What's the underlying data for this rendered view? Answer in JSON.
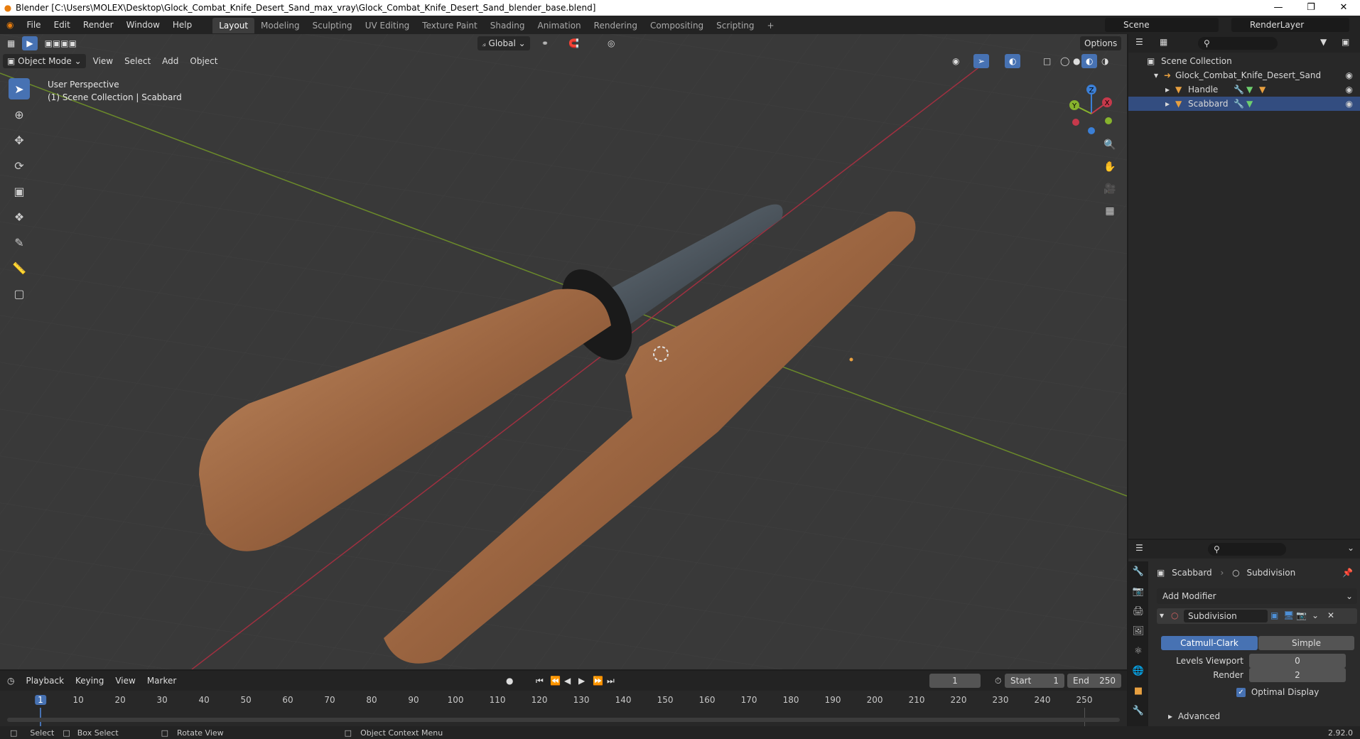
{
  "window": {
    "title": "Blender [C:\\Users\\MOLEX\\Desktop\\Glock_Combat_Knife_Desert_Sand_max_vray\\Glock_Combat_Knife_Desert_Sand_blender_base.blend]",
    "minimize": "—",
    "restore": "❐",
    "close": "✕"
  },
  "menu": [
    "File",
    "Edit",
    "Render",
    "Window",
    "Help"
  ],
  "workspaces": [
    "Layout",
    "Modeling",
    "Sculpting",
    "UV Editing",
    "Texture Paint",
    "Shading",
    "Animation",
    "Rendering",
    "Compositing",
    "Scripting"
  ],
  "workspace_add": "+",
  "scene": {
    "name": "Scene",
    "render_layer": "RenderLayer"
  },
  "viewport": {
    "orientation": "Global",
    "options": "Options",
    "mode": "Object Mode",
    "menus": [
      "View",
      "Select",
      "Add",
      "Object"
    ],
    "info_line1": "User Perspective",
    "info_line2": "(1) Scene Collection | Scabbard",
    "gizmo": {
      "x": "X",
      "y": "Y",
      "z": "Z"
    }
  },
  "outliner": {
    "root": "Scene Collection",
    "collection": "Glock_Combat_Knife_Desert_Sand",
    "objects": [
      "Handle",
      "Scabbard"
    ]
  },
  "properties": {
    "object": "Scabbard",
    "modifier_tab": "Subdivision",
    "add_modifier": "Add Modifier",
    "modifier_name": "Subdivision",
    "method_a": "Catmull-Clark",
    "method_b": "Simple",
    "levels_viewport_label": "Levels Viewport",
    "levels_viewport": "0",
    "render_label": "Render",
    "render": "2",
    "optimal_display": "Optimal Display",
    "advanced": "Advanced"
  },
  "timeline": {
    "menus": [
      "Playback",
      "Keying",
      "View",
      "Marker"
    ],
    "current_frame": "1",
    "start_label": "Start",
    "start": "1",
    "end_label": "End",
    "end": "250",
    "ticks": [
      "1",
      "10",
      "20",
      "30",
      "40",
      "50",
      "60",
      "70",
      "80",
      "90",
      "100",
      "110",
      "120",
      "130",
      "140",
      "150",
      "160",
      "170",
      "180",
      "190",
      "200",
      "210",
      "220",
      "230",
      "240",
      "250"
    ]
  },
  "status": {
    "select": "Select",
    "box_select": "Box Select",
    "rotate_view": "Rotate View",
    "context_menu": "Object Context Menu",
    "version": "2.92.0"
  },
  "colors": {
    "accent": "#4772b3",
    "x_axis": "#c6394b",
    "y_axis": "#87b32d",
    "z_axis": "#3b7fd6",
    "bronze": "#a8704a"
  }
}
